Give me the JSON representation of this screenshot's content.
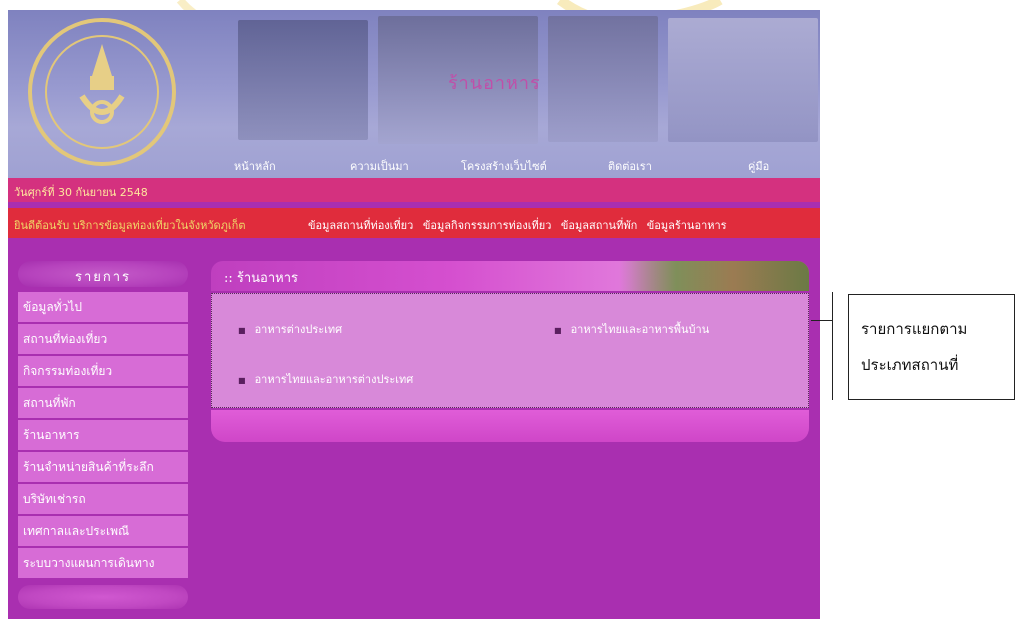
{
  "banner": {
    "title": "ร้านอาหาร",
    "nav": [
      "หน้าหลัก",
      "ความเป็นมา",
      "โครงสร้างเว็บไซต์",
      "ติดต่อเรา",
      "คู่มือ"
    ]
  },
  "datebar": {
    "date_text": "วันศุกร์ที่ 30 กันยายน 2548"
  },
  "welcome": {
    "static_text": "ยินดีต้อนรับ บริการข้อมูลท่องเที่ยวในจังหวัดภูเก็ต",
    "links": [
      "ข้อมูลสถานที่ท่องเที่ยว",
      "ข้อมูลกิจกรรมการท่องเที่ยว",
      "ข้อมูลสถานที่พัก",
      "ข้อมูลร้านอาหาร"
    ]
  },
  "sidebar": {
    "heading": "รายการ",
    "items": [
      "ข้อมูลทั่วไป",
      "สถานที่ท่องเที่ยว",
      "กิจกรรมท่องเที่ยว",
      "สถานที่พัก",
      "ร้านอาหาร",
      "ร้านจำหน่ายสินค้าที่ระลึก",
      "บริษัทเช่ารถ",
      "เทศกาลและประเพณี",
      "ระบบวางแผนการเดินทาง"
    ]
  },
  "content": {
    "heading": ":: ร้านอาหาร",
    "items": [
      "อาหารต่างประเทศ",
      "อาหารไทยและอาหารพื้นบ้าน",
      "อาหารไทยและอาหารต่างประเทศ"
    ]
  },
  "callout": {
    "line1": "รายการแยกตาม",
    "line2": "ประเภทสถานที่"
  },
  "colors": {
    "frame": "#a92fb0",
    "datebar": "#d4317f",
    "welcome": "#e02c3c",
    "menu_item": "#d76cd6",
    "content_bg": "#d889d9"
  }
}
